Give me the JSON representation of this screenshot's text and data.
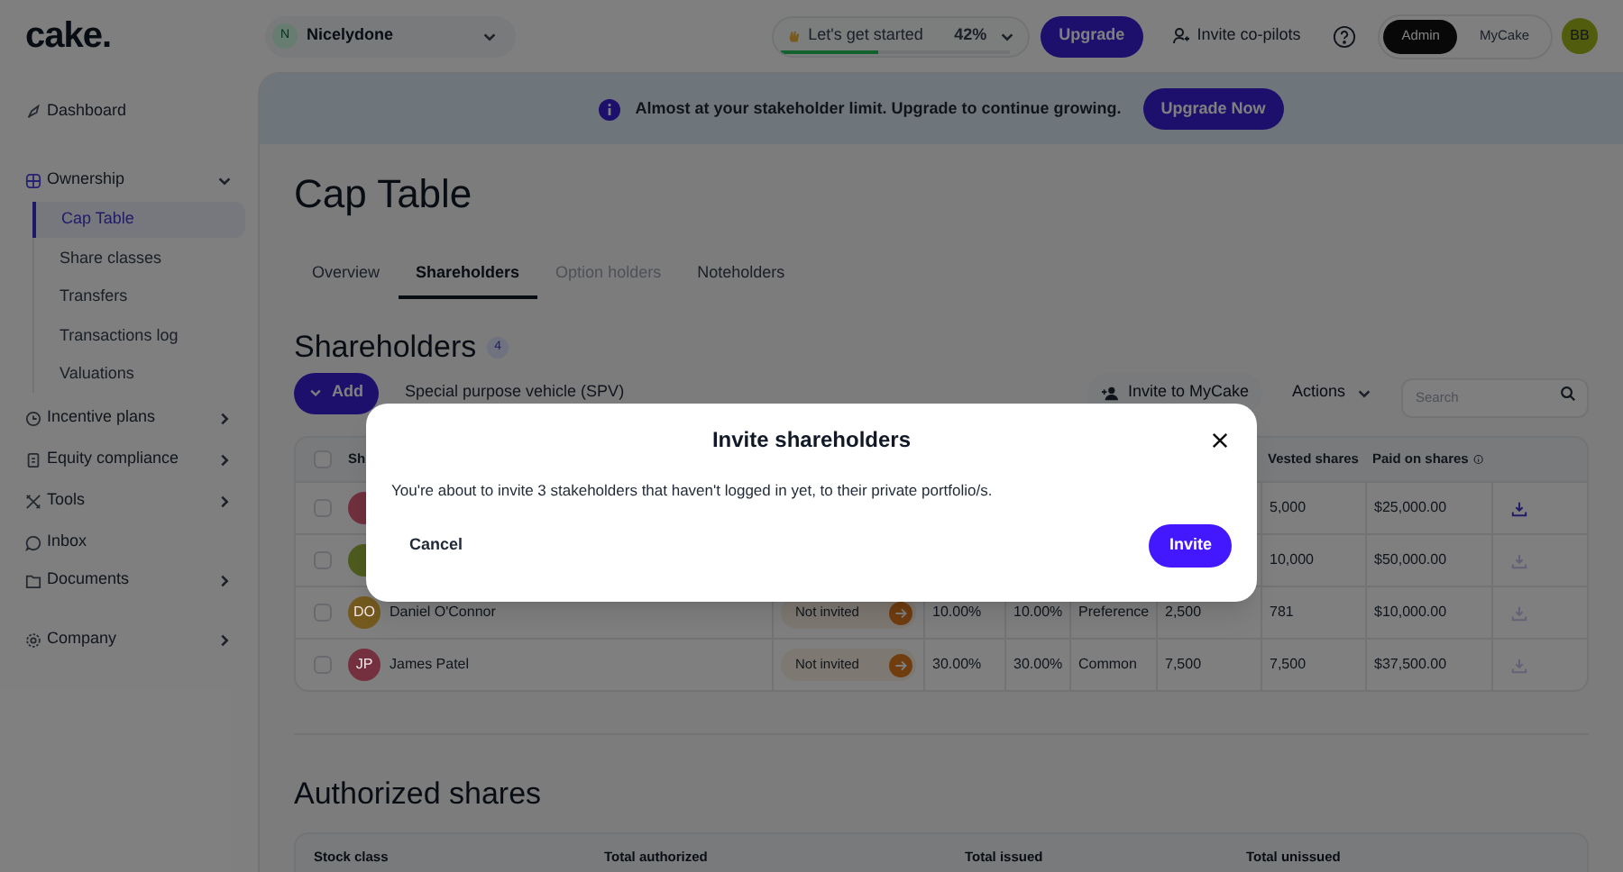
{
  "logo": "cake.",
  "header": {
    "company": {
      "initial": "N",
      "name": "Nicelydone"
    },
    "onboarding": {
      "label": "Let's get started",
      "percent": "42%",
      "level": 0.42
    },
    "upgrade_button": "Upgrade",
    "invite_copilots": "Invite co-pilots",
    "modes": [
      {
        "label": "Admin",
        "selected": true
      },
      {
        "label": "MyCake",
        "selected": false
      }
    ],
    "avatar": "BB"
  },
  "sidebar": {
    "items": [
      {
        "label": "Dashboard"
      },
      {
        "label": "Ownership",
        "expanded": true,
        "children": [
          {
            "label": "Cap Table",
            "selected": true
          },
          {
            "label": "Share classes",
            "selected": false
          },
          {
            "label": "Transfers",
            "selected": false
          },
          {
            "label": "Transactions log",
            "selected": false
          },
          {
            "label": "Valuations",
            "selected": false
          }
        ]
      },
      {
        "label": "Incentive plans",
        "expanded": false
      },
      {
        "label": "Equity compliance",
        "expanded": false
      },
      {
        "label": "Tools",
        "expanded": false
      },
      {
        "label": "Inbox"
      },
      {
        "label": "Documents",
        "expanded": false
      },
      {
        "label": "Company",
        "expanded": false
      }
    ]
  },
  "banner": {
    "message": "Almost at your stakeholder limit. Upgrade to continue growing.",
    "button": "Upgrade Now"
  },
  "page_title": "Cap Table",
  "tabs": [
    {
      "label": "Overview",
      "selected": false,
      "disabled": false
    },
    {
      "label": "Shareholders",
      "selected": true,
      "disabled": false
    },
    {
      "label": "Option holders",
      "selected": false,
      "disabled": true
    },
    {
      "label": "Noteholders",
      "selected": false,
      "disabled": false
    }
  ],
  "shareholders": {
    "title": "Shareholders",
    "count": "4",
    "add_button": "Add",
    "spv": "Special purpose vehicle (SPV)",
    "invite_button": "Invite to MyCake",
    "actions": "Actions",
    "search_placeholder": "Search"
  },
  "table": {
    "columns": [
      "Sh",
      "Vested shares",
      "Paid on shares"
    ],
    "all_checked": false,
    "rows": [
      {
        "checked": false,
        "color": "#70303d",
        "vested": "5,000",
        "paid": "$25,000.00",
        "download_enabled": true
      },
      {
        "checked": false,
        "color": "#4e5b1e",
        "vested": "10,000",
        "paid": "$50,000.00",
        "download_enabled": false
      },
      {
        "checked": false,
        "initials": "DO",
        "color": "#745a1e",
        "name": "Daniel O'Connor",
        "status": "Not invited",
        "percent_1": "10.00%",
        "percent_2": "10.00%",
        "class": "Preference",
        "shares": "2,500",
        "vested": "781",
        "paid": "$10,000.00",
        "download_enabled": false
      },
      {
        "checked": false,
        "initials": "JP",
        "color": "#74303e",
        "name": "James Patel",
        "status": "Not invited",
        "percent_1": "30.00%",
        "percent_2": "30.00%",
        "class": "Common",
        "shares": "7,500",
        "vested": "7,500",
        "paid": "$37,500.00",
        "download_enabled": false
      }
    ]
  },
  "authorized": {
    "title": "Authorized shares",
    "columns": [
      "Stock class",
      "Total authorized",
      "Total issued",
      "Total unissued"
    ]
  },
  "modal": {
    "title": "Invite shareholders",
    "message": "You're about to invite 3 stakeholders that haven't logged in yet, to their private portfolio/s.",
    "cancel": "Cancel",
    "confirm": "Invite"
  }
}
